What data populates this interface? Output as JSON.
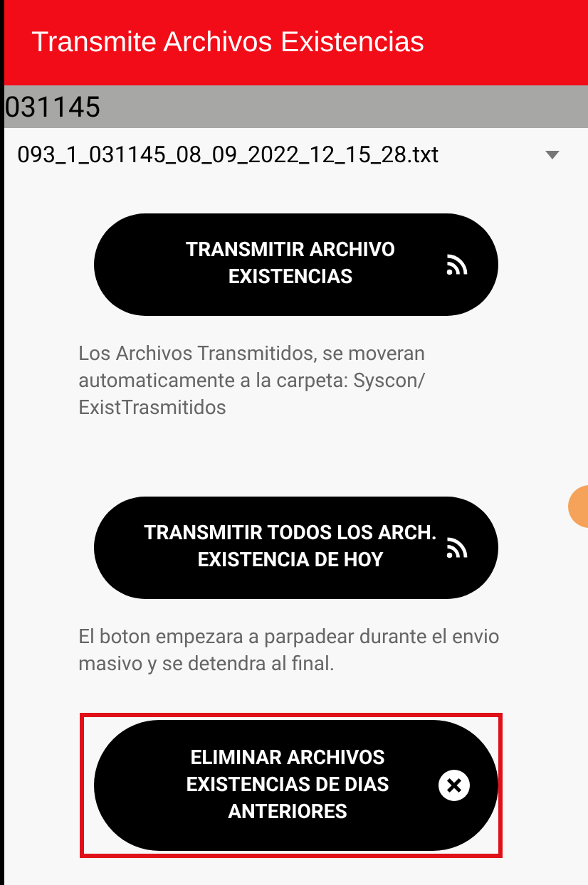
{
  "app_bar": {
    "title": "Transmite Archivos Existencias"
  },
  "store_bar": {
    "text": "031145"
  },
  "file_dropdown": {
    "value": "093_1_031145_08_09_2022_12_15_28.txt"
  },
  "sections": [
    {
      "button": {
        "label": "TRANSMITIR ARCHIVO EXISTENCIAS",
        "kind": "transmit",
        "highlighted": false
      },
      "note": "Los Archivos Transmitidos, se moveran automaticamente a la carpeta: Syscon/ ExistTrasmitidos"
    },
    {
      "button": {
        "label": "TRANSMITIR TODOS LOS ARCH. EXISTENCIA DE HOY",
        "kind": "transmit",
        "highlighted": false
      },
      "note": "El boton empezara a parpadear durante el envio masivo y se detendra al final."
    },
    {
      "button": {
        "label": "ELIMINAR ARCHIVOS EXISTENCIAS DE DIAS ANTERIORES",
        "kind": "delete",
        "highlighted": true
      }
    }
  ]
}
